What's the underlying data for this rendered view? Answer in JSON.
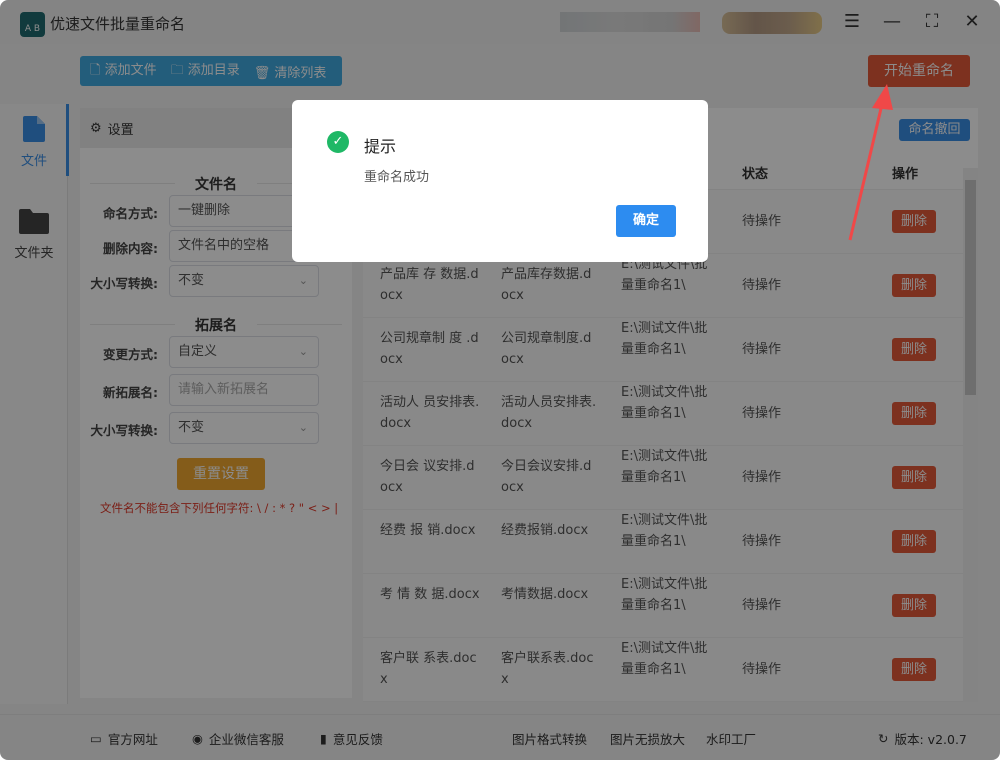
{
  "app": {
    "title": "优速文件批量重命名",
    "logo_text": "A B"
  },
  "toolbar": {
    "add_file": "添加文件",
    "add_folder": "添加目录",
    "clear_list": "清除列表",
    "start_rename": "开始重命名",
    "undo_rename": "命名撤回"
  },
  "sidebar": {
    "items": [
      {
        "label": "文件",
        "active": true
      },
      {
        "label": "文件夹",
        "active": false
      }
    ]
  },
  "settings": {
    "header": "设置",
    "filename_section": "文件名",
    "naming_mode_label": "命名方式:",
    "naming_mode_value": "一键删除",
    "delete_content_label": "删除内容:",
    "delete_content_value": "文件名中的空格",
    "case_label": "大小写转换:",
    "case_value": "不变",
    "ext_section": "拓展名",
    "change_mode_label": "变更方式:",
    "change_mode_value": "自定义",
    "new_ext_label": "新拓展名:",
    "new_ext_placeholder": "请输入新拓展名",
    "ext_case_label": "大小写转换:",
    "ext_case_value": "不变",
    "reset_button": "重置设置",
    "warning": "文件名不能包含下列任何字符: \\ / : * ? \" < > |"
  },
  "table": {
    "headers": {
      "status": "状态",
      "action": "操作"
    },
    "rows": [
      {
        "old": "",
        "new": "",
        "path": "",
        "status": "待操作",
        "action": "删除"
      },
      {
        "old": "产品库 存 数据.docx",
        "new": "产品库存数据.docx",
        "path": "E:\\测试文件\\批量重命名1\\",
        "status": "待操作",
        "action": "删除"
      },
      {
        "old": "公司规章制 度 .docx",
        "new": "公司规章制度.docx",
        "path": "E:\\测试文件\\批量重命名1\\",
        "status": "待操作",
        "action": "删除"
      },
      {
        "old": "活动人 员安排表.docx",
        "new": "活动人员安排表.docx",
        "path": "E:\\测试文件\\批量重命名1\\",
        "status": "待操作",
        "action": "删除"
      },
      {
        "old": "今日会 议安排.docx",
        "new": "今日会议安排.docx",
        "path": "E:\\测试文件\\批量重命名1\\",
        "status": "待操作",
        "action": "删除"
      },
      {
        "old": "经费 报 销.docx",
        "new": "经费报销.docx",
        "path": "E:\\测试文件\\批量重命名1\\",
        "status": "待操作",
        "action": "删除"
      },
      {
        "old": "考 情 数 据.docx",
        "new": "考情数据.docx",
        "path": "E:\\测试文件\\批量重命名1\\",
        "status": "待操作",
        "action": "删除"
      },
      {
        "old": "客户联 系表.docx",
        "new": "客户联系表.docx",
        "path": "E:\\测试文件\\批量重命名1\\",
        "status": "待操作",
        "action": "删除"
      }
    ]
  },
  "footer": {
    "website": "官方网址",
    "wechat": "企业微信客服",
    "feedback": "意见反馈",
    "img_convert": "图片格式转换",
    "img_upscale": "图片无损放大",
    "watermark": "水印工厂",
    "version": "版本: v2.0.7"
  },
  "dialog": {
    "title": "提示",
    "message": "重命名成功",
    "ok": "确定"
  },
  "colors": {
    "accent": "#3a8ee6",
    "danger": "#e35a3a",
    "toolbar": "#40a9e0",
    "reset": "#f0a830",
    "success": "#1fb866",
    "annotation_arrow": "#f04848"
  }
}
